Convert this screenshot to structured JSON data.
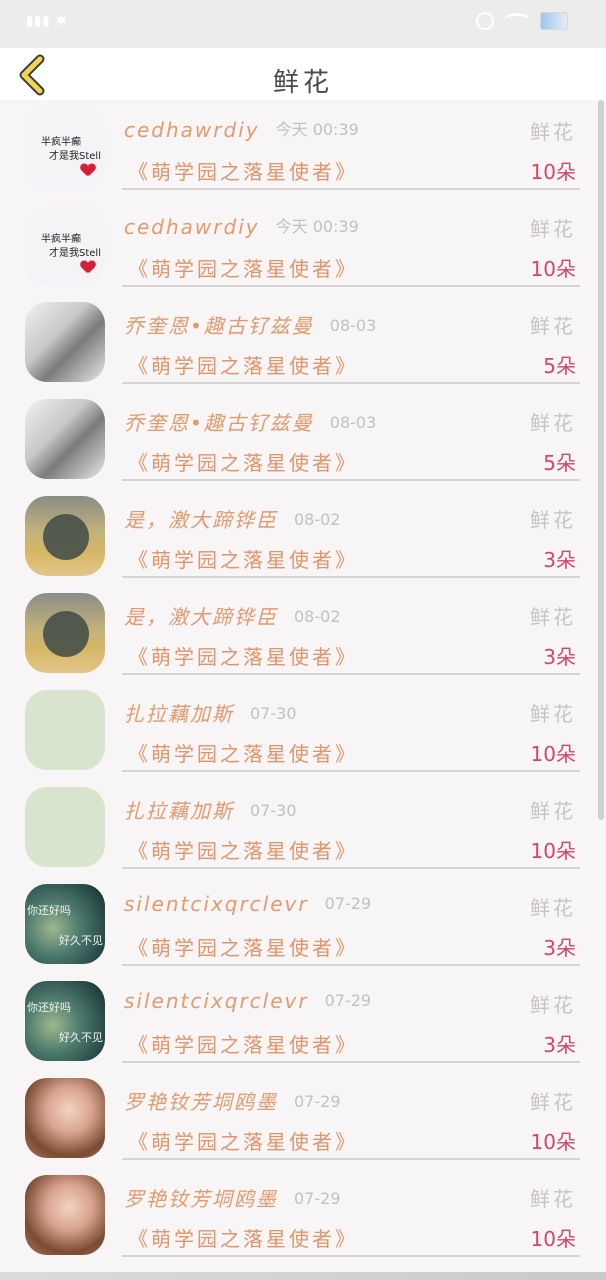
{
  "header": {
    "title": "鲜花"
  },
  "gifts": [
    {
      "name": "cedhawrdiy",
      "time": "今天 00:39",
      "type": "鲜花",
      "item": "《萌学园之落星使者》",
      "qty": "10朵",
      "avatar": "note",
      "avatar_text": [
        "半疯半癫",
        "才是我Stell"
      ]
    },
    {
      "name": "cedhawrdiy",
      "time": "今天 00:39",
      "type": "鲜花",
      "item": "《萌学园之落星使者》",
      "qty": "10朵",
      "avatar": "note",
      "avatar_text": [
        "半疯半癫",
        "才是我Stell"
      ]
    },
    {
      "name": "乔奎恩•趣古钌兹曼",
      "time": "08-03",
      "type": "鲜花",
      "item": "《萌学园之落星使者》",
      "qty": "5朵",
      "avatar": "bw",
      "avatar_text": []
    },
    {
      "name": "乔奎恩•趣古钌兹曼",
      "time": "08-03",
      "type": "鲜花",
      "item": "《萌学园之落星使者》",
      "qty": "5朵",
      "avatar": "bw",
      "avatar_text": []
    },
    {
      "name": "是，激大蹄铧臣",
      "time": "08-02",
      "type": "鲜花",
      "item": "《萌学园之落星使者》",
      "qty": "3朵",
      "avatar": "beach",
      "avatar_text": []
    },
    {
      "name": "是，激大蹄铧臣",
      "time": "08-02",
      "type": "鲜花",
      "item": "《萌学园之落星使者》",
      "qty": "3朵",
      "avatar": "beach",
      "avatar_text": []
    },
    {
      "name": "扎拉藕加斯",
      "time": "07-30",
      "type": "鲜花",
      "item": "《萌学园之落星使者》",
      "qty": "10朵",
      "avatar": "green",
      "avatar_text": []
    },
    {
      "name": "扎拉藕加斯",
      "time": "07-30",
      "type": "鲜花",
      "item": "《萌学园之落星使者》",
      "qty": "10朵",
      "avatar": "green",
      "avatar_text": []
    },
    {
      "name": "silentcixqrclevr",
      "time": "07-29",
      "type": "鲜花",
      "item": "《萌学园之落星使者》",
      "qty": "3朵",
      "avatar": "teal",
      "avatar_text": [
        "你还好吗",
        "好久不见"
      ]
    },
    {
      "name": "silentcixqrclevr",
      "time": "07-29",
      "type": "鲜花",
      "item": "《萌学园之落星使者》",
      "qty": "3朵",
      "avatar": "teal",
      "avatar_text": [
        "你还好吗",
        "好久不见"
      ]
    },
    {
      "name": "罗艳钕芳垌鸥墨",
      "time": "07-29",
      "type": "鲜花",
      "item": "《萌学园之落星使者》",
      "qty": "10朵",
      "avatar": "face",
      "avatar_text": []
    },
    {
      "name": "罗艳钕芳垌鸥墨",
      "time": "07-29",
      "type": "鲜花",
      "item": "《萌学园之落星使者》",
      "qty": "10朵",
      "avatar": "face",
      "avatar_text": []
    }
  ],
  "colors": {
    "name": "#e39a6e",
    "qty": "#d5456a",
    "back": "#f0d552"
  },
  "icons": {
    "back": "chevron-left-icon"
  }
}
